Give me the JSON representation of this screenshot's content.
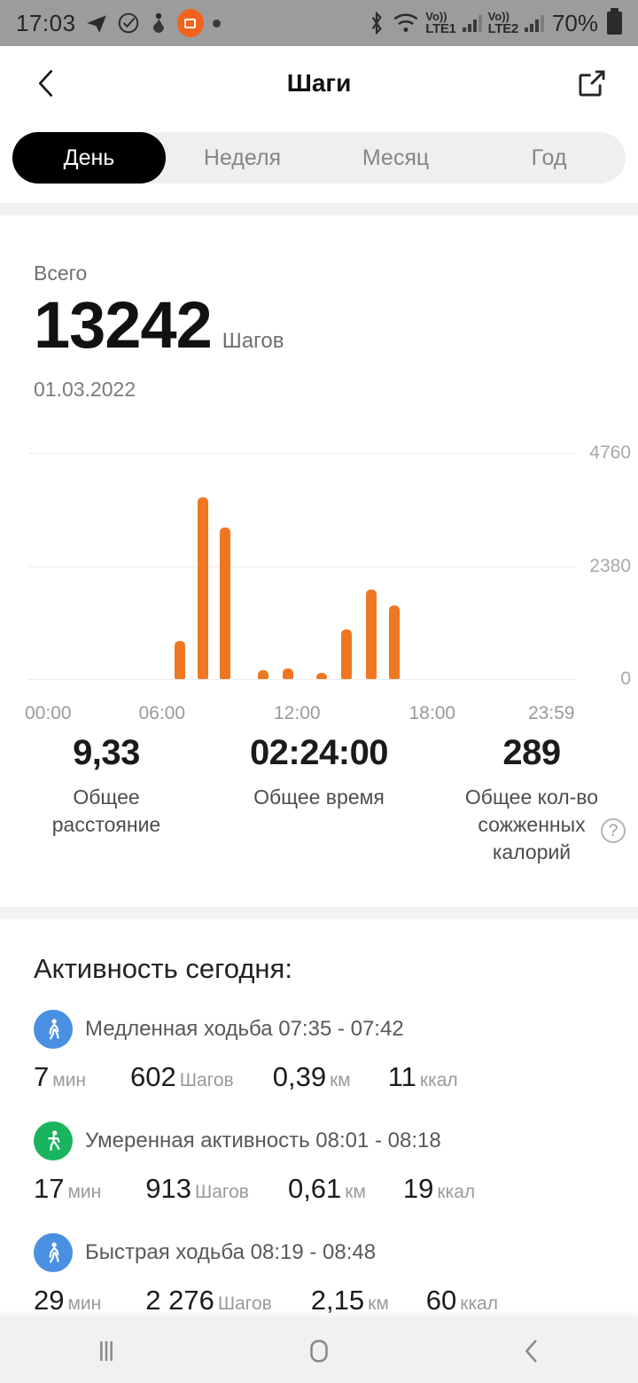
{
  "status_bar": {
    "time": "17:03",
    "icons": [
      "telegram-icon",
      "clock-check-icon",
      "anchor-icon",
      "app-orange-icon",
      "dot-icon"
    ],
    "bluetooth": "bluetooth-icon",
    "wifi": "wifi-icon",
    "sim1_label_top": "Vo))",
    "sim1_label": "LTE1",
    "sim2_label_top": "Vo))",
    "sim2_label": "LTE2",
    "battery_percent": "70%"
  },
  "header": {
    "title": "Шаги",
    "back_icon": "chevron-left-icon",
    "share_icon": "external-link-icon"
  },
  "tabs": {
    "items": [
      {
        "label": "День",
        "active": true
      },
      {
        "label": "Неделя",
        "active": false
      },
      {
        "label": "Месяц",
        "active": false
      },
      {
        "label": "Год",
        "active": false
      }
    ]
  },
  "summary": {
    "total_label": "Всего",
    "total_value": "13242",
    "total_unit": "Шагов",
    "date": "01.03.2022"
  },
  "chart_data": {
    "type": "bar",
    "title": "",
    "xlabel": "",
    "ylabel": "",
    "ylim": [
      0,
      4760
    ],
    "yticks": [
      "0",
      "2380",
      "4760"
    ],
    "xticks": [
      "00:00",
      "06:00",
      "12:00",
      "18:00",
      "23:59"
    ],
    "grid": true,
    "bar_color": "#ef7722",
    "x_hours": [
      6.5,
      7.5,
      8.5,
      10.2,
      11.3,
      12.8,
      13.9,
      15.0,
      16.0
    ],
    "values": [
      800,
      3826,
      3200,
      180,
      220,
      130,
      1050,
      1880,
      1550
    ],
    "categories": [
      "06:30",
      "07:30",
      "08:30",
      "10:12",
      "11:18",
      "12:48",
      "13:54",
      "15:00",
      "16:00"
    ]
  },
  "stats": [
    {
      "value": "9,33",
      "label": "Общее расстояние",
      "help": false
    },
    {
      "value": "02:24:00",
      "label": "Общее время",
      "help": false
    },
    {
      "value": "289",
      "label": "Общее кол-во сожженных калорий",
      "help": true,
      "help_icon": "question-mark-icon"
    }
  ],
  "activity": {
    "title": "Активность сегодня:",
    "items": [
      {
        "icon": "walking-person-icon",
        "icon_color": "#4a90e2",
        "name": "Медленная ходьба 07:35 - 07:42",
        "duration": "7",
        "duration_unit": "мин",
        "steps": "602",
        "steps_unit": "Шагов",
        "distance": "0,39",
        "distance_unit": "км",
        "calories": "11",
        "calories_unit": "ккал"
      },
      {
        "icon": "active-person-icon",
        "icon_color": "#1ab45e",
        "name": "Умеренная активность 08:01 - 08:18",
        "duration": "17",
        "duration_unit": "мин",
        "steps": "913",
        "steps_unit": "Шагов",
        "distance": "0,61",
        "distance_unit": "км",
        "calories": "19",
        "calories_unit": "ккал"
      },
      {
        "icon": "walking-person-icon",
        "icon_color": "#4a90e2",
        "name": "Быстрая ходьба 08:19 - 08:48",
        "duration": "29",
        "duration_unit": "мин",
        "steps": "2 276",
        "steps_unit": "Шагов",
        "distance": "2,15",
        "distance_unit": "км",
        "calories": "60",
        "calories_unit": "ккал"
      }
    ]
  },
  "nav_bar": {
    "recents_icon": "recents-icon",
    "home_icon": "home-icon",
    "back_icon": "back-icon"
  }
}
